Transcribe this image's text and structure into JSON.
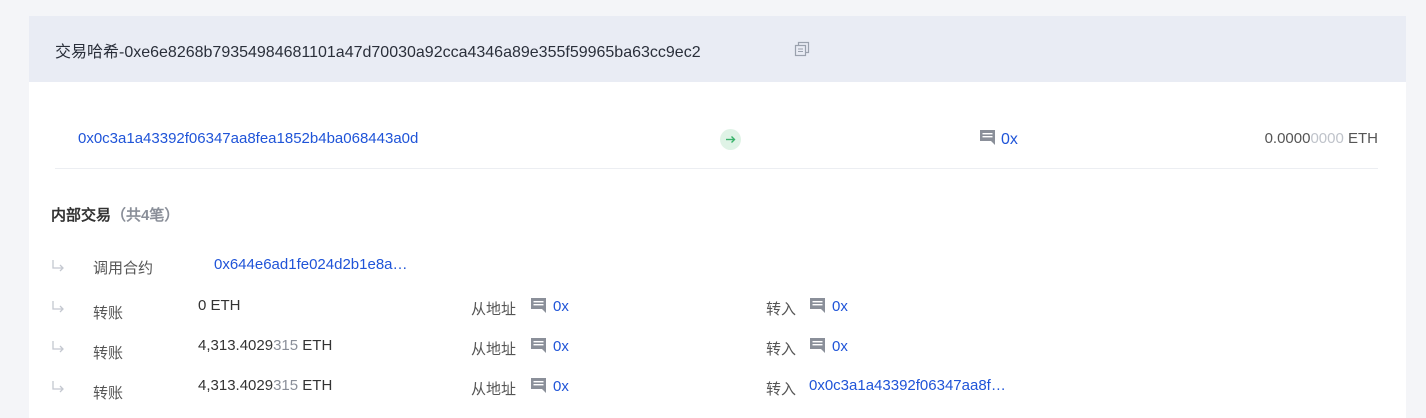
{
  "header": {
    "title": "交易哈希-0xe6e8268b79354984681101a47d70030a92cca4346a89e355f59965ba63cc9ec2"
  },
  "transaction": {
    "from": "0x0c3a1a43392f06347aa8fea1852b4ba068443a0d",
    "to": "0x",
    "value_main": "0.0000",
    "value_dim": "0000",
    "value_unit": " ETH"
  },
  "internal": {
    "title": "内部交易",
    "count": "（共4笔）",
    "rows": [
      {
        "type": "调用合约",
        "contract": "0x644e6ad1fe024d2b1e8a…"
      },
      {
        "type": "转账",
        "amount_main": "0 ETH",
        "from_label": "从地址",
        "from": "0x",
        "to_label": "转入",
        "to": "0x"
      },
      {
        "type": "转账",
        "amount_main": "4,313.4029",
        "amount_dim": "315",
        "amount_unit": " ETH",
        "from_label": "从地址",
        "from": "0x",
        "to_label": "转入",
        "to": "0x"
      },
      {
        "type": "转账",
        "amount_main": "4,313.4029",
        "amount_dim": "315",
        "amount_unit": " ETH",
        "from_label": "从地址",
        "from": "0x",
        "to_label": "转入",
        "to": "0x0c3a1a43392f06347aa8f…"
      }
    ]
  },
  "colors": {
    "link": "#1f54d8",
    "header_bg": "#e9ecf4",
    "arrow": "#38b26a"
  }
}
